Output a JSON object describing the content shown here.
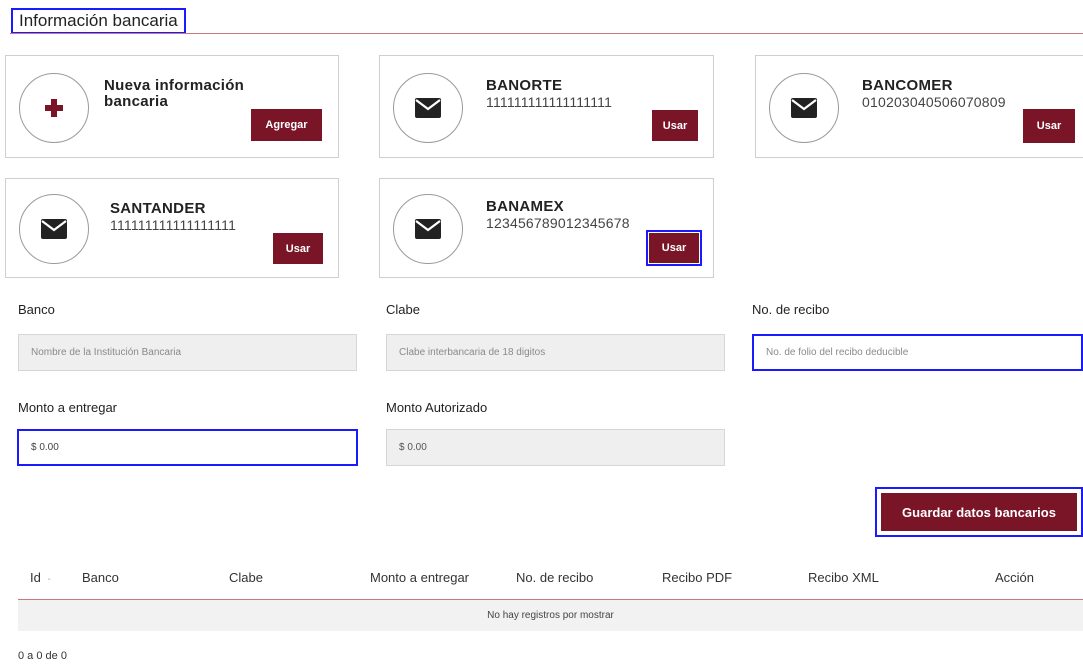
{
  "section_title": "Información bancaria",
  "new_card": {
    "title": "Nueva información bancaria",
    "button": "Agregar",
    "icon": "plus-icon"
  },
  "accounts": [
    {
      "bank": "BANORTE",
      "clabe": "111111111111111111",
      "button": "Usar",
      "icon": "envelope-icon"
    },
    {
      "bank": "BANCOMER",
      "clabe": "010203040506070809",
      "button": "Usar",
      "icon": "envelope-icon"
    },
    {
      "bank": "SANTANDER",
      "clabe": "111111111111111111",
      "button": "Usar",
      "icon": "envelope-icon"
    },
    {
      "bank": "BANAMEX",
      "clabe": "123456789012345678",
      "button": "Usar",
      "icon": "envelope-icon"
    }
  ],
  "form": {
    "banco": {
      "label": "Banco",
      "placeholder": "Nombre de la Institución Bancaria"
    },
    "clabe": {
      "label": "Clabe",
      "placeholder": "Clabe interbancaria de 18 digitos"
    },
    "recibo": {
      "label": "No. de recibo",
      "placeholder": "No. de folio del recibo deducible"
    },
    "monto_entregar": {
      "label": "Monto a entregar",
      "value": "$ 0.00"
    },
    "monto_autorizado": {
      "label": "Monto Autorizado",
      "value": "$ 0.00"
    }
  },
  "save_button": "Guardar datos bancarios",
  "table": {
    "columns": [
      "Id",
      "Banco",
      "Clabe",
      "Monto a entregar",
      "No. de recibo",
      "Recibo PDF",
      "Recibo XML",
      "Acción"
    ],
    "sort_indicator": "-",
    "empty_message": "No hay registros por mostrar"
  },
  "pager": "0 a 0 de 0",
  "colors": {
    "accent": "#7a1528",
    "rule": "#c9787f",
    "highlight": "#1a1aff"
  }
}
